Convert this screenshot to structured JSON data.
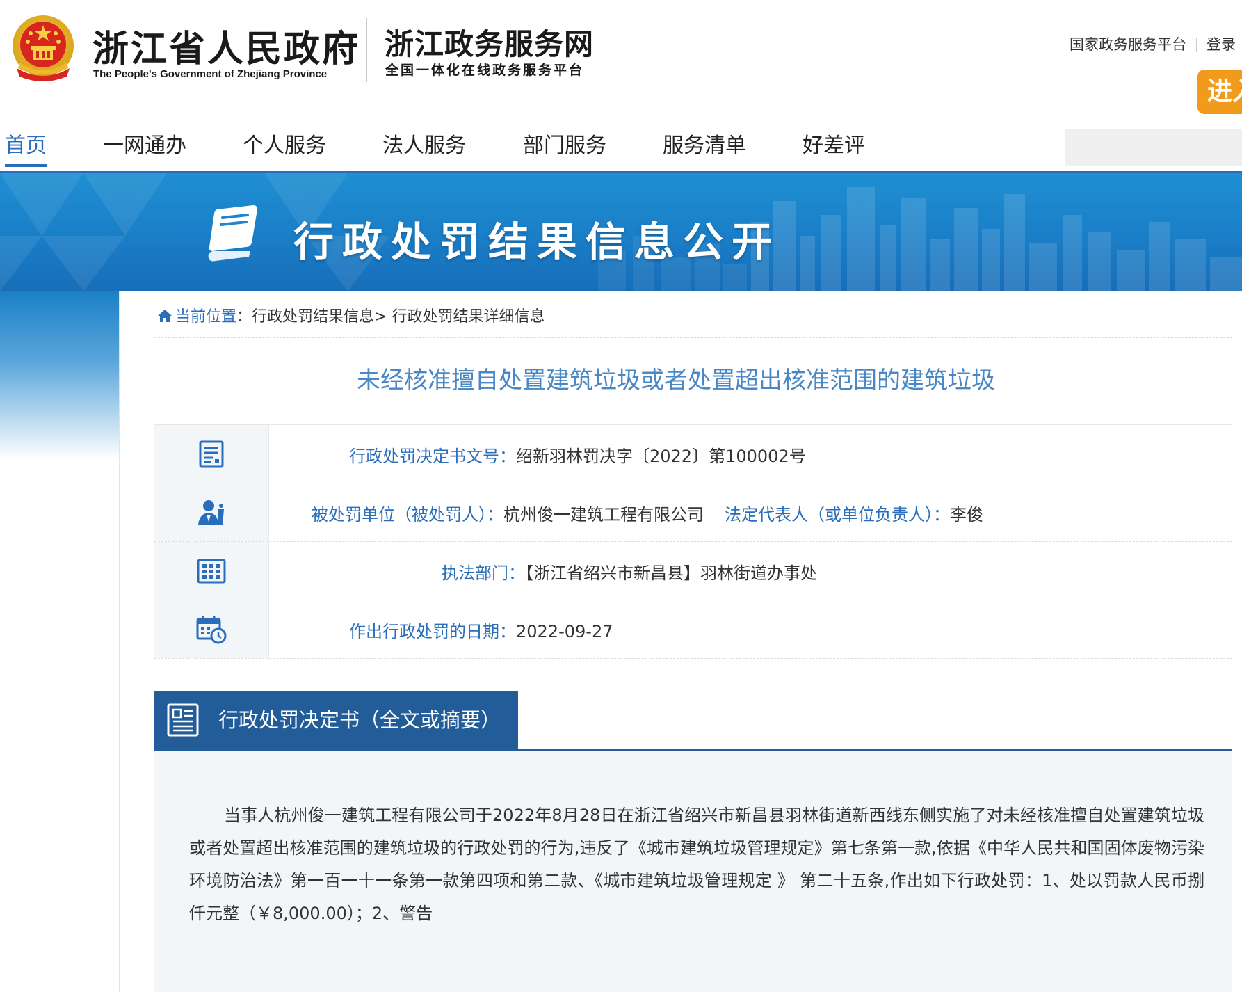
{
  "header": {
    "gov_name_cn": "浙江省人民政府",
    "gov_name_en": "The People's Government of Zhejiang Province",
    "site_title": "浙江政务服务网",
    "site_subtitle": "全国一体化在线政务服务平台",
    "top_links": [
      "国家政务服务平台",
      "登录"
    ],
    "enter_button": "进入"
  },
  "nav": {
    "items": [
      "首页",
      "一网通办",
      "个人服务",
      "法人服务",
      "部门服务",
      "服务清单",
      "好差评"
    ],
    "active_index": 0,
    "search_placeholder": ""
  },
  "banner": {
    "title": "行政处罚结果信息公开"
  },
  "breadcrumb": {
    "home_label": "当前位置",
    "separator": "：",
    "path": "行政处罚结果信息> 行政处罚结果详细信息"
  },
  "page_title": "未经核准擅自处置建筑垃圾或者处置超出核准范围的建筑垃圾",
  "info": {
    "decision_no_label": "行政处罚决定书文号：",
    "decision_no_value": "绍新羽林罚决字〔2022〕第100002号",
    "party_label": "被处罚单位（被处罚人）：",
    "party_value": "杭州俊一建筑工程有限公司",
    "legal_rep_label": "法定代表人（或单位负责人）：",
    "legal_rep_value": "李俊",
    "dept_label": "执法部门：",
    "dept_value": "【浙江省绍兴市新昌县】羽林街道办事处",
    "date_label": "作出行政处罚的日期：",
    "date_value": "2022-09-27"
  },
  "section": {
    "title": "行政处罚决定书（全文或摘要）",
    "body": "当事人杭州俊一建筑工程有限公司于2022年8月28日在浙江省绍兴市新昌县羽林街道新西线东侧实施了对未经核准擅自处置建筑垃圾或者处置超出核准范围的建筑垃圾的行政处罚的行为,违反了《城市建筑垃圾管理规定》第七条第一款,依据《中华人民共和国固体废物污染环境防治法》第一百一十一条第一款第四项和第二款、《城市建筑垃圾管理规定 》 第二十五条,作出如下行政处罚：1、处以罚款人民币捌仟元整（￥8,000.00）；2、警告"
  },
  "colors": {
    "primary_blue": "#2a6ebb",
    "title_blue": "#4a87c5",
    "section_dark_blue": "#225d99",
    "accent_orange": "#f29a1c"
  },
  "icons": {
    "emblem": "national-emblem-icon",
    "book": "book-icon",
    "home": "home-icon",
    "document": "document-icon",
    "person": "person-icon",
    "building": "building-icon",
    "calendar": "calendar-icon",
    "section": "document-list-icon"
  }
}
